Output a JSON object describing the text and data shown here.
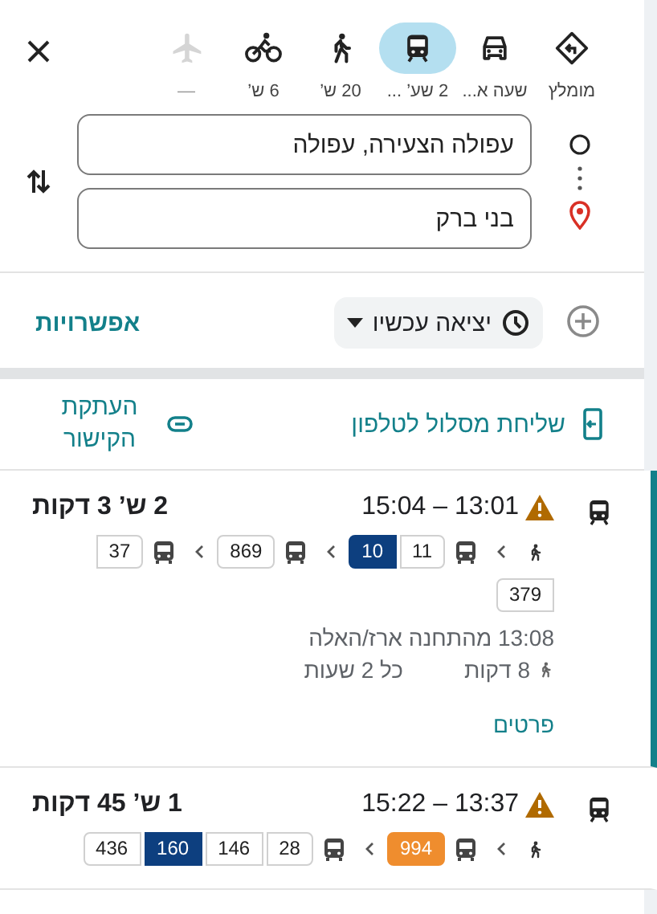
{
  "modes": [
    {
      "kind": "recommended",
      "label": "מומלץ",
      "selected": false,
      "disabled": false
    },
    {
      "kind": "car",
      "label": "שעה א...",
      "selected": false,
      "disabled": false
    },
    {
      "kind": "transit",
      "label": "2 שע’ ...",
      "selected": true,
      "disabled": false
    },
    {
      "kind": "walk",
      "label": "20 ש’",
      "selected": false,
      "disabled": false
    },
    {
      "kind": "bike",
      "label": "6 ש’",
      "selected": false,
      "disabled": false
    },
    {
      "kind": "flight",
      "label": "—",
      "selected": false,
      "disabled": true
    }
  ],
  "origin": {
    "value": "עפולה הצעירה, עפולה"
  },
  "destination": {
    "value": "בני ברק"
  },
  "departure": {
    "label": "יציאה עכשיו"
  },
  "options_link": "אפשרויות",
  "share": {
    "send": "שליחת מסלול לטלפון",
    "copy": "העתקת הקישור"
  },
  "routes": [
    {
      "selected": true,
      "warning": true,
      "times": "13:01 – 15:04",
      "duration": "2 ש’ 3 דקות",
      "legs": [
        {
          "kind": "walk"
        },
        {
          "kind": "bus",
          "lines": [
            {
              "label": "11",
              "color": "#ffffff"
            },
            {
              "label": "10",
              "color": "#0d3f7f"
            }
          ]
        },
        {
          "kind": "bus",
          "lines": [
            {
              "label": "869",
              "color": "#ffffff"
            }
          ]
        },
        {
          "kind": "bus",
          "lines": [
            {
              "label": "37",
              "color": "#ffffff"
            },
            {
              "label": "379",
              "color": "#ffffff"
            }
          ]
        }
      ],
      "departs": "13:08 מהתחנה ארז/האלה",
      "walk": "8 דקות",
      "frequency": "כל 2 שעות",
      "details": "פרטים"
    },
    {
      "selected": false,
      "warning": true,
      "times": "13:37 – 15:22",
      "duration": "1 ש’ 45 דקות",
      "legs": [
        {
          "kind": "walk"
        },
        {
          "kind": "bus",
          "lines": [
            {
              "label": "994",
              "color": "#ef8d2e"
            }
          ]
        },
        {
          "kind": "bus",
          "lines": [
            {
              "label": "28",
              "color": "#ffffff"
            },
            {
              "label": "146",
              "color": "#ffffff"
            },
            {
              "label": "160",
              "color": "#0d3f7f"
            },
            {
              "label": "436",
              "color": "#ffffff"
            }
          ]
        }
      ]
    }
  ]
}
